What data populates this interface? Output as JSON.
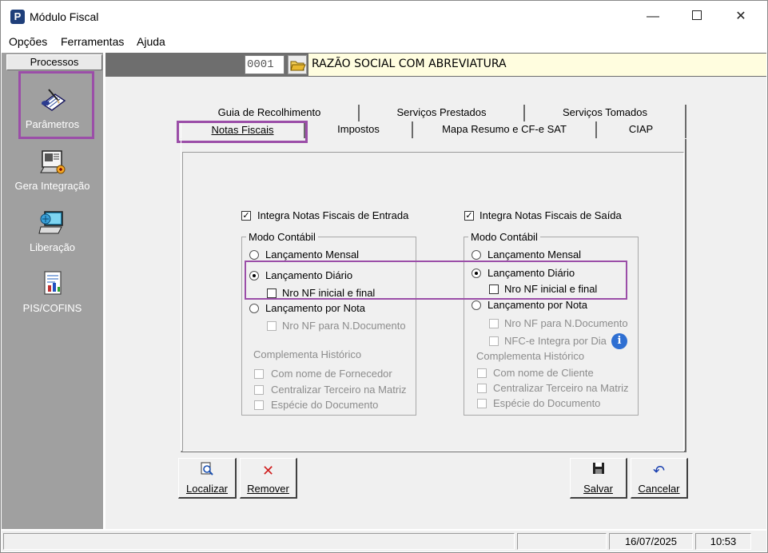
{
  "window": {
    "title": "Módulo Fiscal",
    "icon_letter": "P"
  },
  "menu": [
    "Opções",
    "Ferramentas",
    "Ajuda"
  ],
  "sidebar": {
    "tab": "Processos",
    "items": [
      {
        "label": "Parâmetros",
        "icon": "parameters-icon"
      },
      {
        "label": "Gera Integração",
        "icon": "integration-icon"
      },
      {
        "label": "Liberação",
        "icon": "release-icon"
      },
      {
        "label": "PIS/COFINS",
        "icon": "pis-cofins-icon"
      }
    ]
  },
  "header": {
    "code": "0001",
    "company": "RAZÃO SOCIAL COM ABREVIATURA"
  },
  "tabs": {
    "row1": [
      "Guia de Recolhimento",
      "Serviços Prestados",
      "Serviços Tomados"
    ],
    "row2": [
      "Notas Fiscais",
      "Impostos",
      "Mapa Resumo e CF-e SAT",
      "CIAP"
    ],
    "active": "Notas Fiscais"
  },
  "entrada": {
    "integra_label": "Integra Notas Fiscais de Entrada",
    "integra_checked": true,
    "group_title": "Modo Contábil",
    "mensal": "Lançamento Mensal",
    "diario": "Lançamento Diário",
    "nro_nf": "Nro NF inicial e final",
    "por_nota": "Lançamento por Nota",
    "nro_nf_doc": "Nro NF para N.Documento",
    "hist_title": "Complementa Histórico",
    "hist_1": "Com nome de Fornecedor",
    "hist_2": "Centralizar Terceiro na Matriz",
    "hist_3": "Espécie do Documento",
    "selected_mode": "diario"
  },
  "saida": {
    "integra_label": "Integra Notas Fiscais de Saída",
    "integra_checked": true,
    "group_title": "Modo Contábil",
    "mensal": "Lançamento Mensal",
    "diario": "Lançamento Diário",
    "nro_nf": "Nro NF inicial e final",
    "por_nota": "Lançamento por Nota",
    "nro_nf_doc": "Nro NF para N.Documento",
    "nfce": "NFC-e Integra por Dia",
    "hist_title": "Complementa Histórico",
    "hist_1": "Com nome de Cliente",
    "hist_2": "Centralizar Terceiro na Matriz",
    "hist_3": "Espécie do Documento",
    "selected_mode": "diario"
  },
  "buttons": {
    "localizar": "Localizar",
    "remover": "Remover",
    "salvar": "Salvar",
    "cancelar": "Cancelar"
  },
  "status": {
    "date": "16/07/2025",
    "time": "10:53"
  },
  "colors": {
    "highlight": "#9b4ea8",
    "sidebar": "#a0a0a0",
    "header_bg": "#fffddf"
  }
}
